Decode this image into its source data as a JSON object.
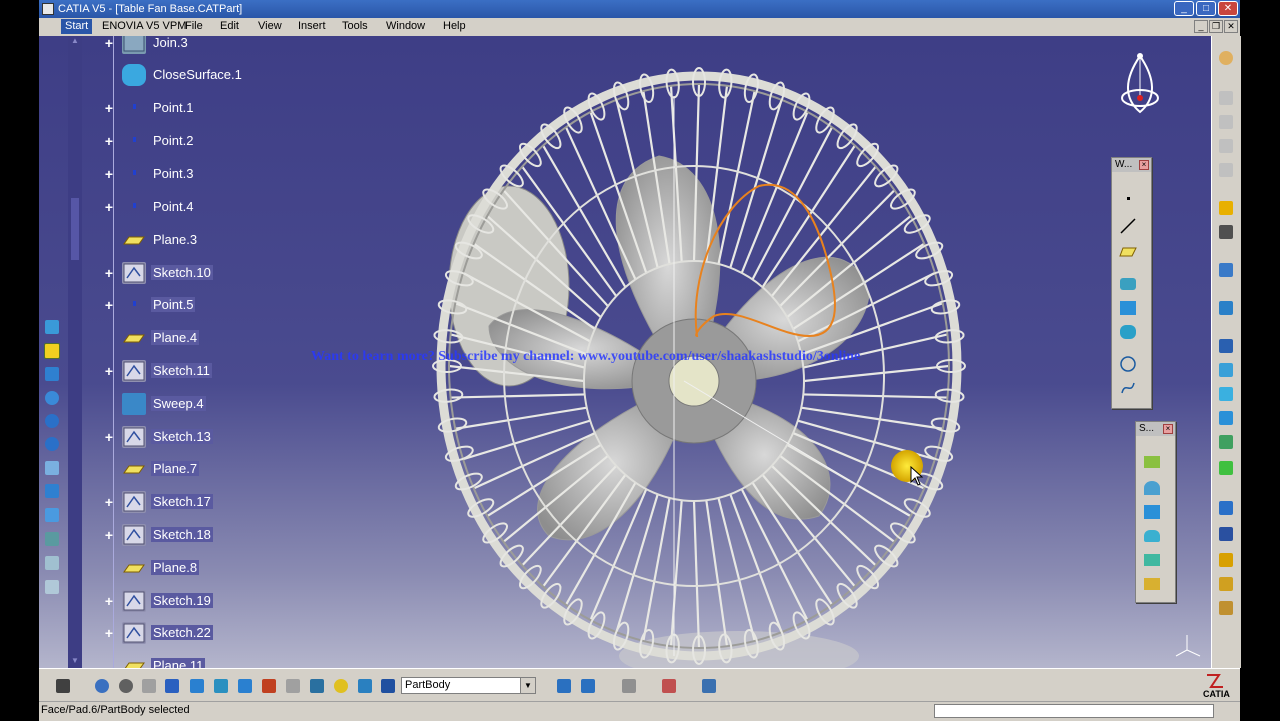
{
  "window": {
    "title": "CATIA V5 - [Table Fan Base.CATPart]",
    "minimize": "_",
    "maximize": "□",
    "close": "✕"
  },
  "menu": {
    "items": [
      "Start",
      "ENOVIA V5 VPM",
      "File",
      "Edit",
      "View",
      "Insert",
      "Tools",
      "Window",
      "Help"
    ]
  },
  "tree": {
    "nodes": [
      {
        "label": "Join.3",
        "icon": "join-icon",
        "expandable": true
      },
      {
        "label": "CloseSurface.1",
        "icon": "close-surface-icon",
        "expandable": false
      },
      {
        "label": "Point.1",
        "icon": "point-icon",
        "expandable": true
      },
      {
        "label": "Point.2",
        "icon": "point-icon",
        "expandable": true
      },
      {
        "label": "Point.3",
        "icon": "point-icon",
        "expandable": true
      },
      {
        "label": "Point.4",
        "icon": "point-icon",
        "expandable": true
      },
      {
        "label": "Plane.3",
        "icon": "plane-icon",
        "expandable": false
      },
      {
        "label": "Sketch.10",
        "icon": "sketch-icon",
        "expandable": true
      },
      {
        "label": "Point.5",
        "icon": "point-icon",
        "expandable": true
      },
      {
        "label": "Plane.4",
        "icon": "plane-icon",
        "expandable": false
      },
      {
        "label": "Sketch.11",
        "icon": "sketch-icon",
        "expandable": true
      },
      {
        "label": "Sweep.4",
        "icon": "sweep-icon",
        "expandable": false
      },
      {
        "label": "Sketch.13",
        "icon": "sketch-icon",
        "expandable": true
      },
      {
        "label": "Plane.7",
        "icon": "plane-icon",
        "expandable": false
      },
      {
        "label": "Sketch.17",
        "icon": "sketch-icon",
        "expandable": true
      },
      {
        "label": "Sketch.18",
        "icon": "sketch-icon",
        "expandable": true
      },
      {
        "label": "Plane.8",
        "icon": "plane-icon",
        "expandable": false
      },
      {
        "label": "Sketch.19",
        "icon": "sketch-icon",
        "expandable": true
      },
      {
        "label": "Sketch.22",
        "icon": "sketch-icon",
        "expandable": true
      },
      {
        "label": "Plane.11",
        "icon": "plane-icon",
        "expandable": false
      }
    ]
  },
  "viewport": {
    "watermark": "Want to learn more? Subscribe my channel: www.youtube.com/user/shaakashstudio/3online"
  },
  "palettes": {
    "wireframe": {
      "title": "W..."
    },
    "surfaces": {
      "title": "S..."
    }
  },
  "bottom_toolbar": {
    "body_select": "PartBody"
  },
  "statusbar": {
    "text": "Face/Pad.6/PartBody selected"
  },
  "logo": {
    "text": "CATIA"
  },
  "colors": {
    "accent": "#2a56a8",
    "viewport_top": "#3e3e86",
    "selection_orange": "#e8821e"
  }
}
